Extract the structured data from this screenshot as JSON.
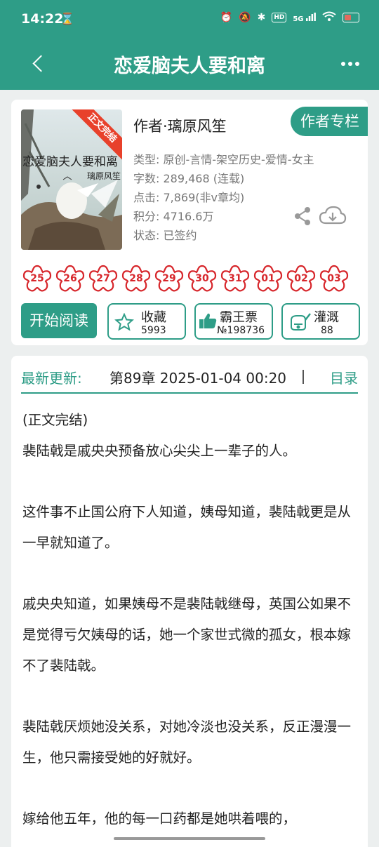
{
  "status_bar": {
    "time": "14:22",
    "icons": [
      "hourglass-icon",
      "alarm-icon",
      "mute-icon",
      "bluetooth-icon",
      "hd-icon",
      "5g-signal-icon",
      "wifi-icon",
      "battery-icon"
    ],
    "hd_label": "HD",
    "network_label": "5G"
  },
  "nav": {
    "title": "恋爱脑夫人要和离"
  },
  "book": {
    "cover": {
      "ribbon": "正文完结",
      "title": "恋爱脑夫人要和离",
      "author": "璃原风笙"
    },
    "author_label": "作者·璃原风笙",
    "author_column_button": "作者专栏",
    "meta": [
      "类型: 原创-言情-架空历史-爱情-女主",
      "字数: 289,468 (连载)",
      "点击: 7,869(非v章均)",
      "积分: 4716.6万",
      "状态: 已签约"
    ],
    "badges": [
      "25",
      "26",
      "27",
      "28",
      "29",
      "30",
      "31",
      "01",
      "02",
      "03"
    ],
    "badge_color": "#d7262b",
    "start_reading": "开始阅读",
    "favorite": {
      "label": "收藏",
      "count": "5993"
    },
    "ticket": {
      "label": "霸王票",
      "count": "№198736"
    },
    "water": {
      "label": "灌溉",
      "count": "88"
    }
  },
  "update": {
    "label": "最新更新:",
    "text": "第89章 2025-01-04 00:20",
    "toc": "目录"
  },
  "content": [
    "(正文完结)",
    "裴陆戟是戚央央预备放心尖尖上一辈子的人。",
    "",
    "这件事不止国公府下人知道，姨母知道，裴陆戟更是从一早就知道了。",
    "",
    "戚央央知道，如果姨母不是裴陆戟继母，英国公如果不是觉得亏欠姨母的话，她一个家世式微的孤女，根本嫁不了裴陆戟。",
    "",
    "裴陆戟厌烦她没关系，对她冷淡也没关系，反正漫漫一生，他只需接受她的好就好。",
    "",
    "嫁给他五年，他的每一口药都是她哄着喂的，"
  ],
  "colors": {
    "accent": "#2e9d87",
    "badge": "#d7262b"
  }
}
